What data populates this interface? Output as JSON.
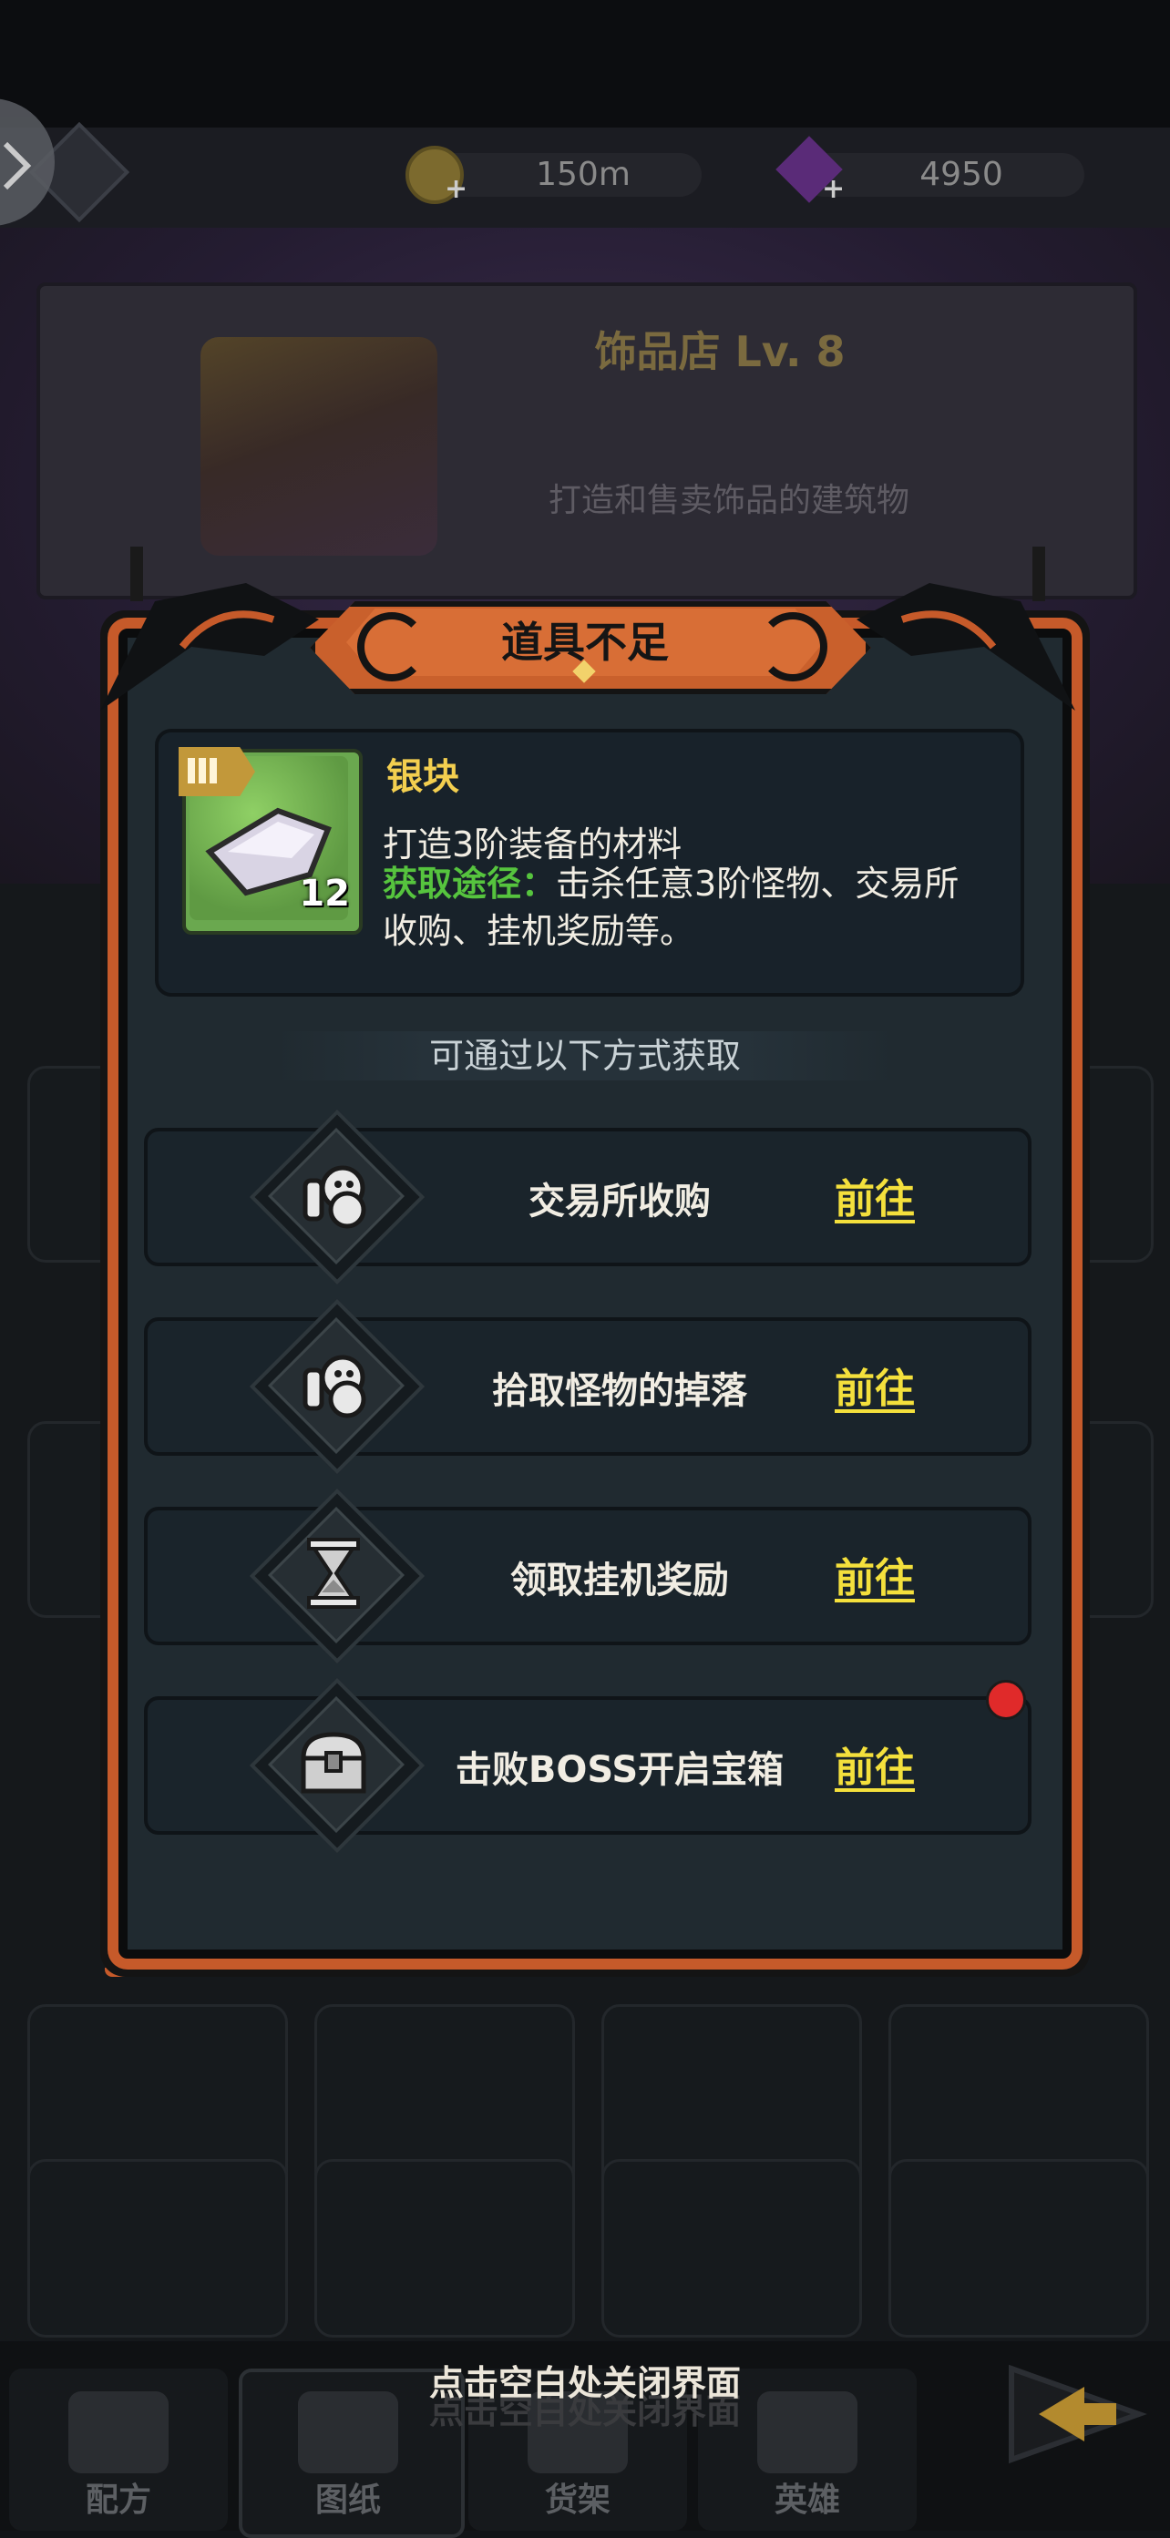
{
  "resources": {
    "gold_value": "150m",
    "gem_value": "4950"
  },
  "shop": {
    "title": "饰品店  Lv. 8",
    "description": "打造和售卖饰品的建筑物"
  },
  "dialog": {
    "title": "道具不足",
    "item": {
      "name": "银块",
      "count": "12",
      "description": "打造3阶装备的材料",
      "source_label": "获取途径：",
      "source_text": "击杀任意3阶怪物、交易所",
      "source_text_line2": "收购、挂机奖励等。"
    },
    "section_label": "可通过以下方式获取",
    "sources": [
      {
        "label": "交易所收购",
        "action": "前往",
        "icon": "ghost-hand-icon"
      },
      {
        "label": "拾取怪物的掉落",
        "action": "前往",
        "icon": "ghost-hand-icon"
      },
      {
        "label": "领取挂机奖励",
        "action": "前往",
        "icon": "hourglass-icon"
      },
      {
        "label": "击败BOSS开启宝箱",
        "action": "前往",
        "icon": "treasure-chest-icon"
      }
    ]
  },
  "close_hint": "点击空白处关闭界面",
  "bottom_nav": [
    {
      "label": "配方"
    },
    {
      "label": "图纸"
    },
    {
      "label": "货架"
    },
    {
      "label": "英雄"
    }
  ],
  "colors": {
    "accent_orange": "#c65a2a",
    "item_name": "#f3cf4f",
    "source_label_green": "#56c43e",
    "link_yellow": "#f4e03c",
    "notification_red": "#e02a2a"
  }
}
